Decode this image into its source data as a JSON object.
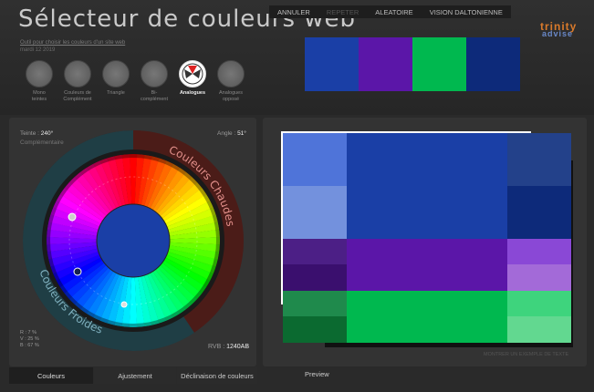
{
  "app": {
    "title": "Sélecteur de couleurs web",
    "subtitle": "Outil pour choisir les couleurs d'un site web",
    "date": "mardi 12 2019"
  },
  "menu": {
    "items": [
      {
        "label": "ANNULER",
        "dim": false
      },
      {
        "label": "REPETER",
        "dim": true
      },
      {
        "label": "ALEATOIRE",
        "dim": false
      },
      {
        "label": "VISION DALTONIENNE",
        "dim": false
      }
    ]
  },
  "logo": {
    "line1": "trinity",
    "line2": "advise"
  },
  "swatches": [
    "#1a3fa6",
    "#5b16a8",
    "#00b84f",
    "#0d2a7a"
  ],
  "modes": [
    {
      "label": "Mono\nteintes",
      "active": false
    },
    {
      "label": "Couleurs de\nComplément",
      "active": false
    },
    {
      "label": "Triangle",
      "active": false
    },
    {
      "label": "Bi-\ncomplément",
      "active": false
    },
    {
      "label": "Analogues",
      "active": true
    },
    {
      "label": "Analogues\nopposé",
      "active": false
    }
  ],
  "wheel_info": {
    "hue_label": "Teinte :",
    "hue_value": "240°",
    "complement_label": "Complémentaire",
    "angle_label": "Angle :",
    "angle_value": "51°",
    "warm_label": "Couleurs Chaudes",
    "cold_label": "Couleurs Froides",
    "rgb_r": "R : 7 %",
    "rgb_v": "V : 25 %",
    "rgb_b": "B : 67 %",
    "rvb_label": "RVB :",
    "rvb_value": "1240AB",
    "center_color": "#1a3fa6"
  },
  "tabs": [
    {
      "label": "Couleurs",
      "active": true
    },
    {
      "label": "Ajustement",
      "active": false
    },
    {
      "label": "Déclinaison de couleurs",
      "active": false
    }
  ],
  "preview": {
    "label": "Preview",
    "show_text": "MONTRER UN EXEMPLE DE TEXTE",
    "colors": {
      "blue_light1": "#4f74d9",
      "blue_light2": "#7391dd",
      "blue_main": "#1a3fa6",
      "blue_dark1": "#23418a",
      "blue_dark2": "#0d2a7a",
      "purple_d1": "#4c1f86",
      "purple_d2": "#3a0f6e",
      "purple_main": "#5b16a8",
      "purple_l1": "#8a48d6",
      "purple_l2": "#a36ad8",
      "green_d1": "#1f8a4c",
      "green_d2": "#0b6a30",
      "green_main": "#00b84f",
      "green_l1": "#3ed47d",
      "green_l2": "#62d890"
    }
  }
}
